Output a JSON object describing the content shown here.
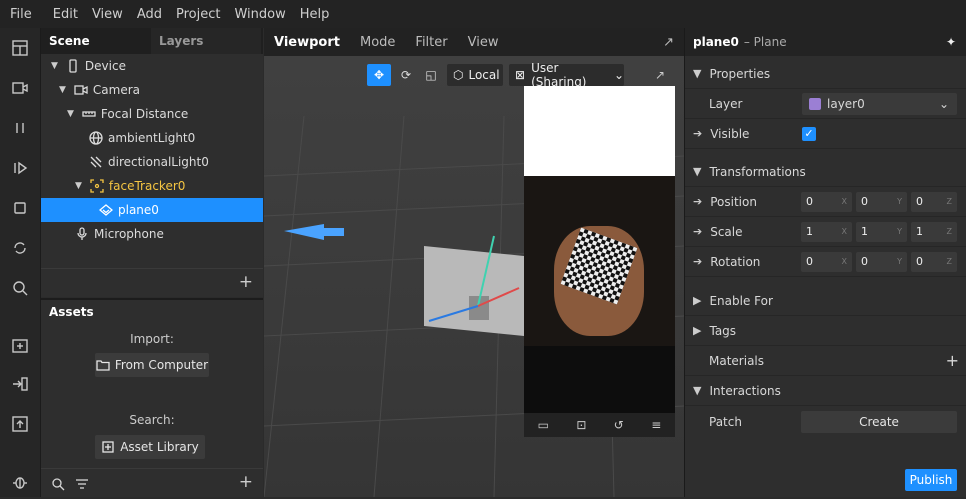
{
  "menu": [
    "File",
    "Edit",
    "View",
    "Add",
    "Project",
    "Window",
    "Help"
  ],
  "scene": {
    "tab_scene": "Scene",
    "tab_layers": "Layers",
    "items": [
      {
        "label": "Device"
      },
      {
        "label": "Camera"
      },
      {
        "label": "Focal Distance"
      },
      {
        "label": "ambientLight0"
      },
      {
        "label": "directionalLight0"
      },
      {
        "label": "faceTracker0"
      },
      {
        "label": "plane0"
      },
      {
        "label": "Microphone"
      }
    ],
    "add": "+"
  },
  "assets": {
    "title": "Assets",
    "import_label": "Import:",
    "from_computer": "From Computer",
    "search_label": "Search:",
    "asset_library": "Asset Library",
    "add": "+"
  },
  "viewport": {
    "tabs": [
      "Viewport",
      "Mode",
      "Filter",
      "View"
    ],
    "local": "Local",
    "device": "User (Sharing)"
  },
  "inspector": {
    "name": "plane0",
    "type": "– Plane",
    "properties": "Properties",
    "layer_label": "Layer",
    "layer_value": "layer0",
    "visible_label": "Visible",
    "transformations": "Transformations",
    "position": "Position",
    "scale": "Scale",
    "rotation": "Rotation",
    "pos": [
      "0",
      "0",
      "0"
    ],
    "scl": [
      "1",
      "1",
      "1"
    ],
    "rot": [
      "0",
      "0",
      "0"
    ],
    "axes": [
      "X",
      "Y",
      "Z"
    ],
    "enable_for": "Enable For",
    "tags": "Tags",
    "materials": "Materials",
    "interactions": "Interactions",
    "patch": "Patch",
    "create": "Create",
    "publish": "Publish"
  },
  "colors": {
    "accent": "#1e90ff",
    "highlight": "#f5c542",
    "layer_swatch": "#9b7fd4"
  }
}
